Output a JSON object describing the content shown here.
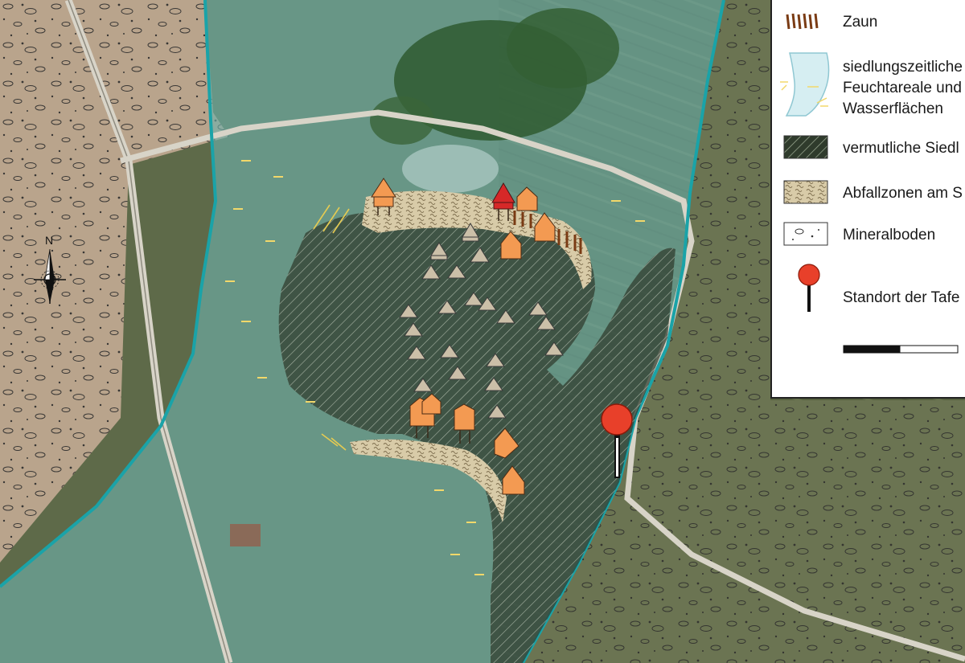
{
  "map": {
    "north_label": "N",
    "colors": {
      "wetland_outline": "#1aa3a8",
      "wetland_fill": "#6fb8b4",
      "settlement_hatch": "#2f3b2c",
      "refuse_zone": "#d8cba8",
      "mineral_soil": "#b9a98c",
      "hut_existing": "#cbbfa8",
      "hut_reconstructed": "#f39a52",
      "hut_highlight": "#d62828",
      "fence": "#7a3b14",
      "location_marker": "#e8402a",
      "reed": "#f2d86a"
    }
  },
  "legend": {
    "items": [
      {
        "icon": "fence-icon",
        "label": "Zaun"
      },
      {
        "icon": "wetland-icon",
        "label_lines": [
          "siedlungszeitliche",
          "Feuchtareale und",
          "Wasserflächen"
        ]
      },
      {
        "icon": "settlement-hatch-icon",
        "label": "vermutliche Siedl"
      },
      {
        "icon": "refuse-zone-icon",
        "label": "Abfallzonen am S"
      },
      {
        "icon": "mineral-soil-icon",
        "label": "Mineralboden"
      },
      {
        "icon": "location-pin-icon",
        "label": "Standort der Tafe"
      }
    ],
    "scale_bar": {
      "segments": 2
    }
  }
}
